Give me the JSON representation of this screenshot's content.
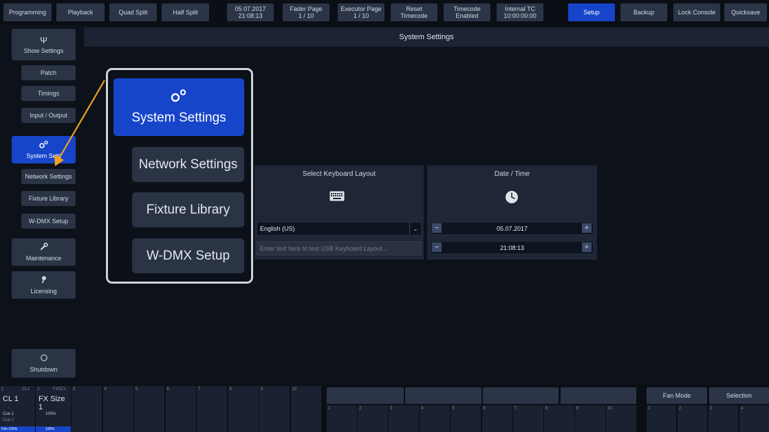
{
  "topbar": {
    "programming": "Programming",
    "playback": "Playback",
    "quad_split": "Quad Split",
    "half_split": "Half Split",
    "date": "05.07.2017",
    "time": "21:08:13",
    "fader_page_label": "Fader Page",
    "fader_page_value": "1 / 10",
    "executor_page_label": "Executor Page",
    "executor_page_value": "1 / 10",
    "reset_label": "Reset",
    "reset_sub": "Timecode",
    "timecode_label": "Timecode",
    "timecode_sub": "Enabled",
    "internal_tc_label": "Internal TC",
    "internal_tc_value": "10:00:00:00",
    "setup": "Setup",
    "backup": "Backup",
    "lock_console": "Lock Console",
    "quicksave": "Quicksave"
  },
  "sidebar": {
    "show_settings": "Show Settings",
    "patch": "Patch",
    "timings": "Timings",
    "input_output": "Input / Output",
    "system_settings": "System Setti",
    "network_settings": "Network Settings",
    "fixture_library": "Fixture Library",
    "wdmx_setup": "W-DMX Setup",
    "maintenance": "Maintenance",
    "licensing": "Licensing",
    "shutdown": "Shutdown"
  },
  "header": {
    "title": "System Settings"
  },
  "keyboard_panel": {
    "title": "Select Keyboard Layout",
    "layout_value": "English (US)",
    "test_placeholder": "Enter text here to test USB Keyboard Layout..."
  },
  "datetime_panel": {
    "title": "Date / Time",
    "date_value": "05.07.2017",
    "time_value": "21:08:13"
  },
  "zoom": {
    "system_settings": "System Settings",
    "network_settings": "Network Settings",
    "fixture_library": "Fixture Library",
    "wdmx_setup": "W-DMX Setup"
  },
  "bottom": {
    "cell1_num": "1",
    "cell1_tag": "CL1",
    "cell1_name": "CL 1",
    "cell1_cue1": "Cue 1",
    "cell1_cue2": "Cue 2",
    "cell1_dim": "Dim 100%",
    "cell1_dash": "-",
    "cell2_num": "2",
    "cell2_tag": "FXSZ1",
    "cell2_name": "FX Size 1",
    "cell2_val": "100%",
    "cell2_val2": "100%",
    "fan_mode": "Fan Mode",
    "selection": "Selection",
    "slot_numbers": [
      "3",
      "4",
      "5",
      "6",
      "7",
      "8",
      "9",
      "10"
    ],
    "lower_numbers": [
      "1",
      "2",
      "3",
      "4",
      "5",
      "6",
      "7",
      "8",
      "9",
      "10"
    ],
    "right_numbers": [
      "1",
      "2",
      "3",
      "4"
    ]
  },
  "colors": {
    "accent": "#1745c9",
    "button": "#2b3547",
    "background": "#0d1119",
    "callout_arrow": "#f0a321"
  }
}
